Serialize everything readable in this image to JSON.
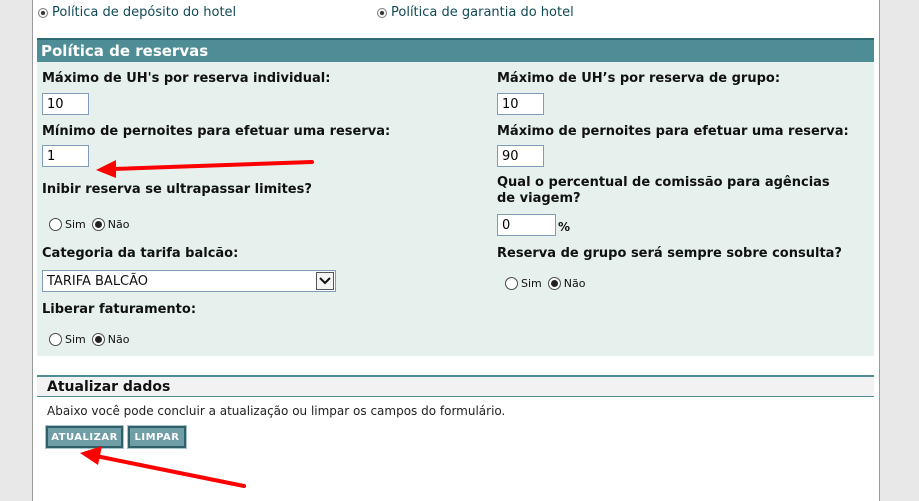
{
  "top_links": [
    {
      "label": "Política de depósito do hotel"
    },
    {
      "label": "Política de garantia do hotel"
    }
  ],
  "reservas": {
    "title": "Política de reservas",
    "max_uh_individual": {
      "label": "Máximo de UH's por reserva individual:",
      "value": "10"
    },
    "max_uh_grupo": {
      "label": "Máximo de UH’s por reserva de grupo:",
      "value": "10"
    },
    "min_pernoites": {
      "label": "Mínimo de pernoites para efetuar uma reserva:",
      "value": "1"
    },
    "max_pernoites": {
      "label": "Máximo de pernoites para efetuar uma reserva:",
      "value": "90"
    },
    "inibir": {
      "label": "Inibir reserva se ultrapassar limites?",
      "options": [
        "Sim",
        "Não"
      ],
      "selected": "Não"
    },
    "comissao": {
      "label": "Qual o percentual de comissão para agências de viagem?",
      "value": "0",
      "unit": "%"
    },
    "categoria": {
      "label": "Categoria da tarifa balcão:",
      "selected": "TARIFA BALCÃO"
    },
    "grupo_consulta": {
      "label": "Reserva de grupo será sempre sobre consulta?",
      "options": [
        "Sim",
        "Não"
      ],
      "selected": "Não"
    },
    "liberar": {
      "label": "Liberar faturamento:",
      "options": [
        "Sim",
        "Não"
      ],
      "selected": "Não"
    }
  },
  "atualizar": {
    "title": "Atualizar dados",
    "description": "Abaixo você pode concluir a atualização ou limpar os campos do formulário.",
    "update_label": "ATUALIZAR",
    "clear_label": "LIMPAR"
  },
  "colors": {
    "header_teal": "#4e8d95",
    "panel_bg": "#e6f0ec",
    "button_teal": "#6f9ea6",
    "annotation_red": "#ff0000"
  }
}
